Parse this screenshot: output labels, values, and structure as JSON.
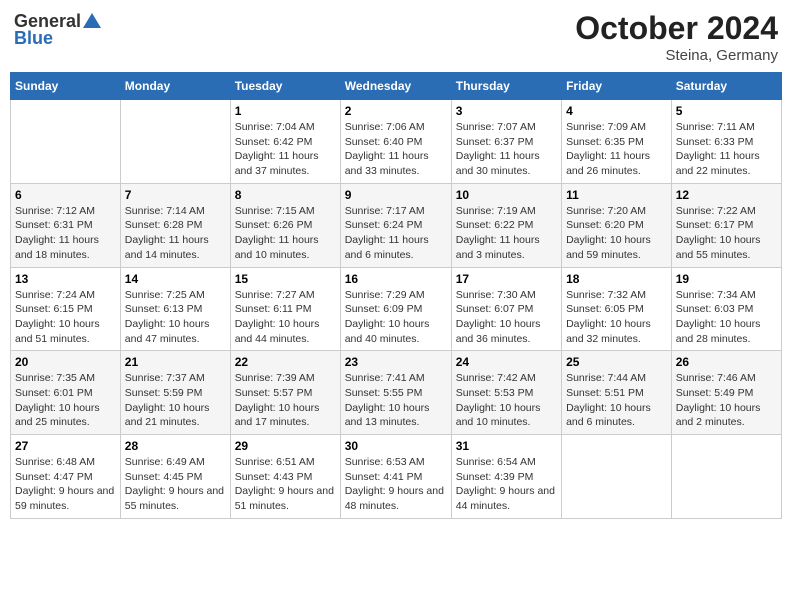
{
  "header": {
    "logo_general": "General",
    "logo_blue": "Blue",
    "month_year": "October 2024",
    "location": "Steina, Germany"
  },
  "days_of_week": [
    "Sunday",
    "Monday",
    "Tuesday",
    "Wednesday",
    "Thursday",
    "Friday",
    "Saturday"
  ],
  "weeks": [
    [
      {
        "day": "",
        "detail": ""
      },
      {
        "day": "",
        "detail": ""
      },
      {
        "day": "1",
        "detail": "Sunrise: 7:04 AM\nSunset: 6:42 PM\nDaylight: 11 hours and 37 minutes."
      },
      {
        "day": "2",
        "detail": "Sunrise: 7:06 AM\nSunset: 6:40 PM\nDaylight: 11 hours and 33 minutes."
      },
      {
        "day": "3",
        "detail": "Sunrise: 7:07 AM\nSunset: 6:37 PM\nDaylight: 11 hours and 30 minutes."
      },
      {
        "day": "4",
        "detail": "Sunrise: 7:09 AM\nSunset: 6:35 PM\nDaylight: 11 hours and 26 minutes."
      },
      {
        "day": "5",
        "detail": "Sunrise: 7:11 AM\nSunset: 6:33 PM\nDaylight: 11 hours and 22 minutes."
      }
    ],
    [
      {
        "day": "6",
        "detail": "Sunrise: 7:12 AM\nSunset: 6:31 PM\nDaylight: 11 hours and 18 minutes."
      },
      {
        "day": "7",
        "detail": "Sunrise: 7:14 AM\nSunset: 6:28 PM\nDaylight: 11 hours and 14 minutes."
      },
      {
        "day": "8",
        "detail": "Sunrise: 7:15 AM\nSunset: 6:26 PM\nDaylight: 11 hours and 10 minutes."
      },
      {
        "day": "9",
        "detail": "Sunrise: 7:17 AM\nSunset: 6:24 PM\nDaylight: 11 hours and 6 minutes."
      },
      {
        "day": "10",
        "detail": "Sunrise: 7:19 AM\nSunset: 6:22 PM\nDaylight: 11 hours and 3 minutes."
      },
      {
        "day": "11",
        "detail": "Sunrise: 7:20 AM\nSunset: 6:20 PM\nDaylight: 10 hours and 59 minutes."
      },
      {
        "day": "12",
        "detail": "Sunrise: 7:22 AM\nSunset: 6:17 PM\nDaylight: 10 hours and 55 minutes."
      }
    ],
    [
      {
        "day": "13",
        "detail": "Sunrise: 7:24 AM\nSunset: 6:15 PM\nDaylight: 10 hours and 51 minutes."
      },
      {
        "day": "14",
        "detail": "Sunrise: 7:25 AM\nSunset: 6:13 PM\nDaylight: 10 hours and 47 minutes."
      },
      {
        "day": "15",
        "detail": "Sunrise: 7:27 AM\nSunset: 6:11 PM\nDaylight: 10 hours and 44 minutes."
      },
      {
        "day": "16",
        "detail": "Sunrise: 7:29 AM\nSunset: 6:09 PM\nDaylight: 10 hours and 40 minutes."
      },
      {
        "day": "17",
        "detail": "Sunrise: 7:30 AM\nSunset: 6:07 PM\nDaylight: 10 hours and 36 minutes."
      },
      {
        "day": "18",
        "detail": "Sunrise: 7:32 AM\nSunset: 6:05 PM\nDaylight: 10 hours and 32 minutes."
      },
      {
        "day": "19",
        "detail": "Sunrise: 7:34 AM\nSunset: 6:03 PM\nDaylight: 10 hours and 28 minutes."
      }
    ],
    [
      {
        "day": "20",
        "detail": "Sunrise: 7:35 AM\nSunset: 6:01 PM\nDaylight: 10 hours and 25 minutes."
      },
      {
        "day": "21",
        "detail": "Sunrise: 7:37 AM\nSunset: 5:59 PM\nDaylight: 10 hours and 21 minutes."
      },
      {
        "day": "22",
        "detail": "Sunrise: 7:39 AM\nSunset: 5:57 PM\nDaylight: 10 hours and 17 minutes."
      },
      {
        "day": "23",
        "detail": "Sunrise: 7:41 AM\nSunset: 5:55 PM\nDaylight: 10 hours and 13 minutes."
      },
      {
        "day": "24",
        "detail": "Sunrise: 7:42 AM\nSunset: 5:53 PM\nDaylight: 10 hours and 10 minutes."
      },
      {
        "day": "25",
        "detail": "Sunrise: 7:44 AM\nSunset: 5:51 PM\nDaylight: 10 hours and 6 minutes."
      },
      {
        "day": "26",
        "detail": "Sunrise: 7:46 AM\nSunset: 5:49 PM\nDaylight: 10 hours and 2 minutes."
      }
    ],
    [
      {
        "day": "27",
        "detail": "Sunrise: 6:48 AM\nSunset: 4:47 PM\nDaylight: 9 hours and 59 minutes."
      },
      {
        "day": "28",
        "detail": "Sunrise: 6:49 AM\nSunset: 4:45 PM\nDaylight: 9 hours and 55 minutes."
      },
      {
        "day": "29",
        "detail": "Sunrise: 6:51 AM\nSunset: 4:43 PM\nDaylight: 9 hours and 51 minutes."
      },
      {
        "day": "30",
        "detail": "Sunrise: 6:53 AM\nSunset: 4:41 PM\nDaylight: 9 hours and 48 minutes."
      },
      {
        "day": "31",
        "detail": "Sunrise: 6:54 AM\nSunset: 4:39 PM\nDaylight: 9 hours and 44 minutes."
      },
      {
        "day": "",
        "detail": ""
      },
      {
        "day": "",
        "detail": ""
      }
    ]
  ]
}
